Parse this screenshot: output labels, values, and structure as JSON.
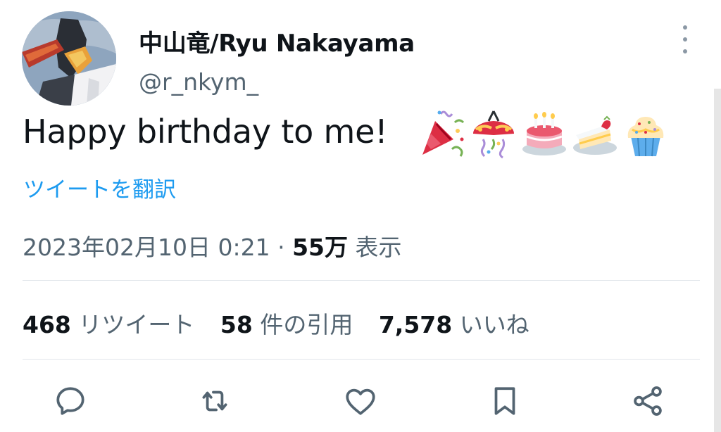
{
  "user": {
    "display_name": "中山竜/Ryu Nakayama",
    "handle": "@r_nkym_",
    "avatar": "avatar"
  },
  "tweet": {
    "text": "Happy birthday to me!",
    "emojis": [
      "party-popper",
      "confetti-ball",
      "birthday-cake",
      "shortcake",
      "cupcake"
    ],
    "translate_label": "ツイートを翻訳"
  },
  "meta": {
    "timestamp": "2023年02月10日 0:21",
    "separator": "·",
    "views_count": "55万",
    "views_label": "表示"
  },
  "stats": {
    "retweets_count": "468",
    "retweets_label": "リツイート",
    "quotes_count": "58",
    "quotes_label": "件の引用",
    "likes_count": "7,578",
    "likes_label": "いいね"
  },
  "actions": {
    "icons": [
      "reply-icon",
      "retweet-icon",
      "like-icon",
      "bookmark-icon",
      "share-icon"
    ]
  },
  "colors": {
    "link": "#1d9bf0",
    "secondary_text": "#536471",
    "primary_text": "#0f1419",
    "icon": "#536471"
  }
}
